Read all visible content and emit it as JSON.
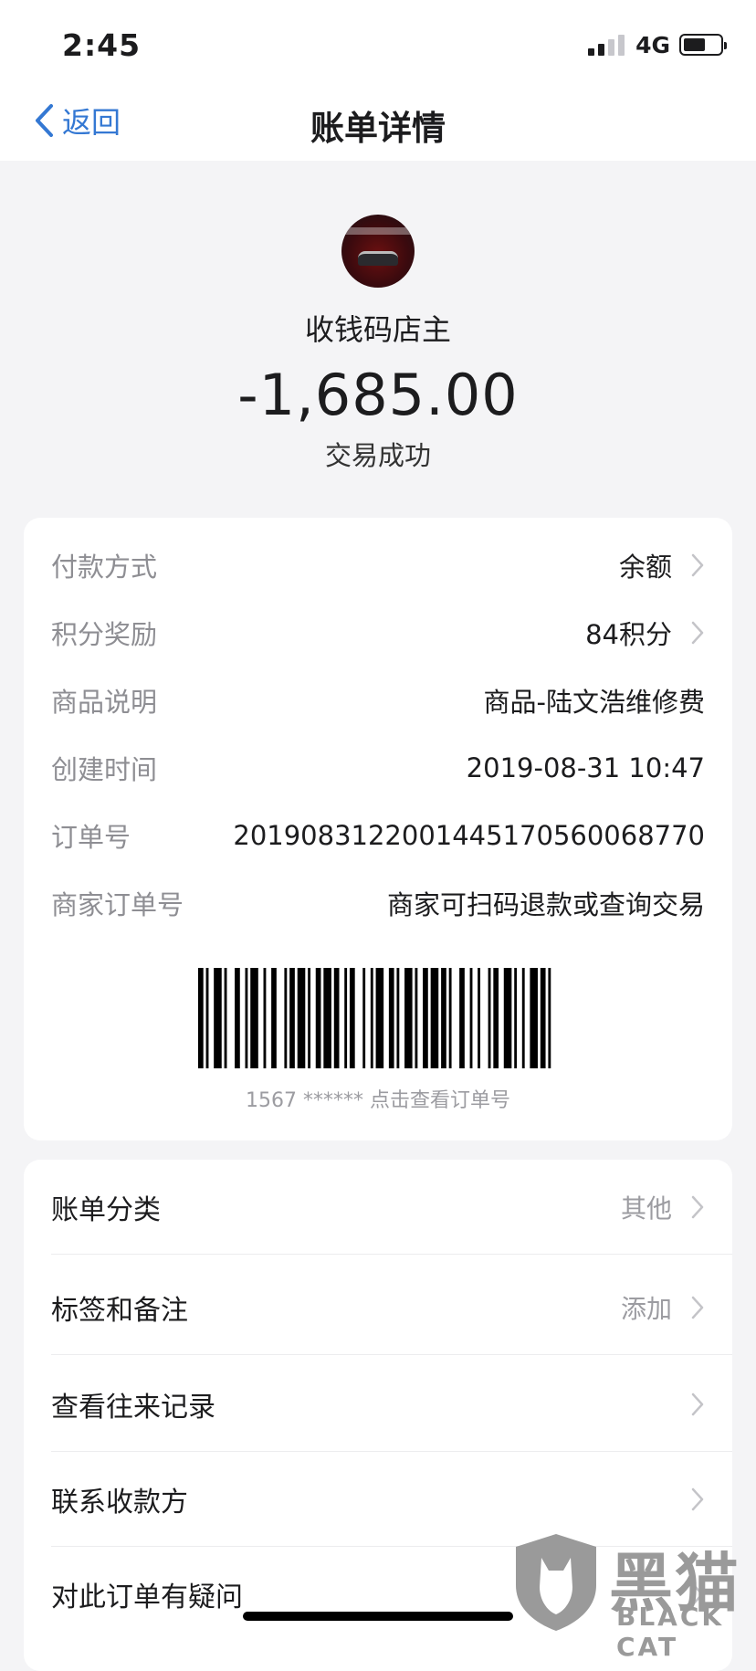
{
  "status_bar": {
    "time": "2:45",
    "network": "4G"
  },
  "nav": {
    "back_label": "返回",
    "title": "账单详情"
  },
  "header": {
    "merchant_name": "收钱码店主",
    "amount": "-1,685.00",
    "status": "交易成功"
  },
  "details": [
    {
      "label": "付款方式",
      "value": "余额",
      "chevron": true
    },
    {
      "label": "积分奖励",
      "value": "84积分",
      "chevron": true
    },
    {
      "label": "商品说明",
      "value": "商品-陆文浩维修费",
      "chevron": false
    },
    {
      "label": "创建时间",
      "value": "2019-08-31 10:47",
      "chevron": false
    },
    {
      "label": "订单号",
      "value": "2019083122001445170560068770",
      "chevron": false
    },
    {
      "label": "商家订单号",
      "value": "商家可扫码退款或查询交易",
      "chevron": false
    }
  ],
  "barcode_caption": "1567 ****** 点击查看订单号",
  "actions": [
    {
      "label": "账单分类",
      "value": "其他"
    },
    {
      "label": "标签和备注",
      "value": "添加"
    },
    {
      "label": "查看往来记录",
      "value": ""
    },
    {
      "label": "联系收款方",
      "value": ""
    },
    {
      "label": "对此订单有疑问",
      "value": ""
    }
  ],
  "watermark": {
    "brand": "黑猫",
    "sub": "BLACK CAT"
  },
  "colors": {
    "accent": "#3478d3",
    "background": "#f4f4f6",
    "secondary_text": "#8e8e93"
  }
}
